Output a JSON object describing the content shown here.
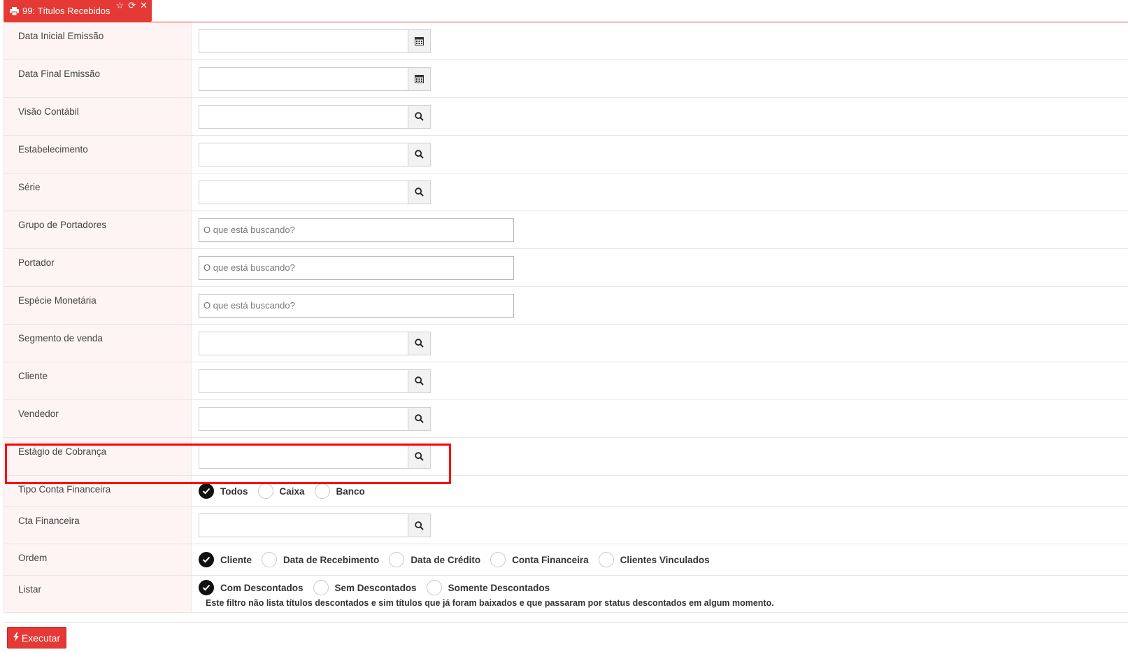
{
  "tab": {
    "title": "99: Títulos Recebidos",
    "icons": [
      "print-icon",
      "star-icon",
      "refresh-icon",
      "close-icon"
    ]
  },
  "fields": {
    "data_inicial": {
      "label": "Data Inicial Emissão",
      "value": ""
    },
    "data_final": {
      "label": "Data Final Emissão",
      "value": ""
    },
    "visao_contabil": {
      "label": "Visão Contábil",
      "value": ""
    },
    "estabelecimento": {
      "label": "Estabelecimento",
      "value": ""
    },
    "serie": {
      "label": "Série",
      "value": ""
    },
    "grupo_portadores": {
      "label": "Grupo de Portadores",
      "placeholder": "O que está buscando?"
    },
    "portador": {
      "label": "Portador",
      "placeholder": "O que está buscando?"
    },
    "especie_monetaria": {
      "label": "Espécie Monetária",
      "placeholder": "O que está buscando?"
    },
    "segmento_venda": {
      "label": "Segmento de venda",
      "value": ""
    },
    "cliente": {
      "label": "Cliente",
      "value": ""
    },
    "vendedor": {
      "label": "Vendedor",
      "value": ""
    },
    "estagio_cobranca": {
      "label": "Estágio de Cobrança",
      "value": ""
    },
    "tipo_conta": {
      "label": "Tipo Conta Financeira",
      "options": [
        "Todos",
        "Caixa",
        "Banco"
      ],
      "selected": "Todos"
    },
    "cta_financeira": {
      "label": "Cta Financeira",
      "value": ""
    },
    "ordem": {
      "label": "Ordem",
      "options": [
        "Cliente",
        "Data de Recebimento",
        "Data de Crédito",
        "Conta Financeira",
        "Clientes Vinculados"
      ],
      "selected": "Cliente"
    },
    "listar": {
      "label": "Listar",
      "options": [
        "Com Descontados",
        "Sem Descontados",
        "Somente Descontados"
      ],
      "selected": "Com Descontados",
      "note": "Este filtro não lista títulos descontados e sim títulos que já foram baixados e que passaram por status descontados em algum momento."
    }
  },
  "actions": {
    "execute_label": "Executar"
  },
  "colors": {
    "accent": "#e53935",
    "highlight": "#ff0000",
    "label_bg": "#fdf4f3"
  }
}
